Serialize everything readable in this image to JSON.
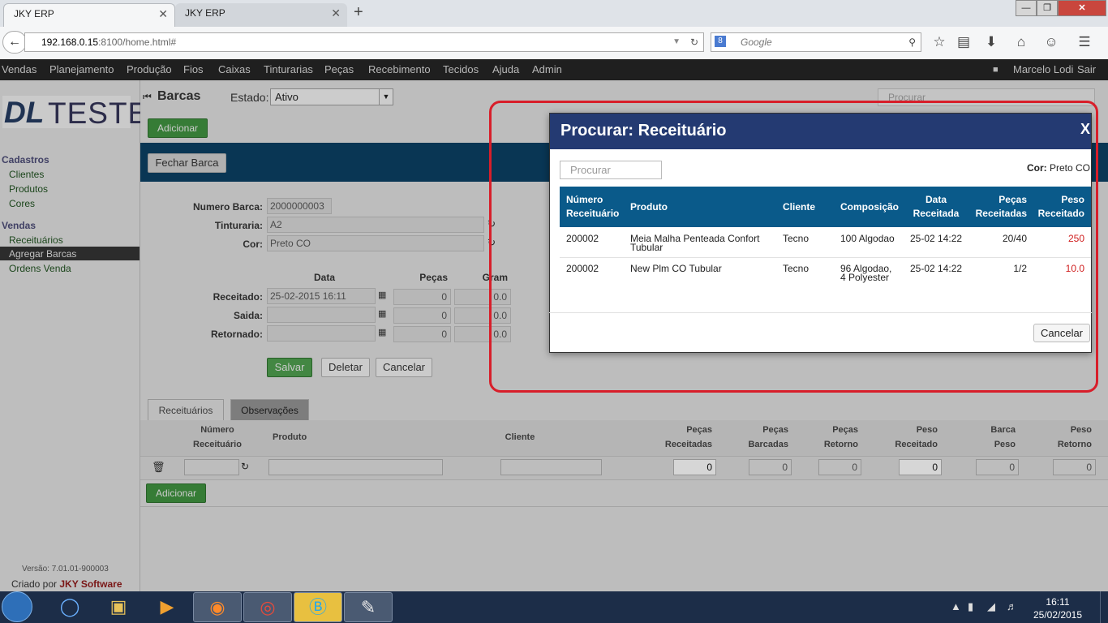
{
  "browser": {
    "tabs": [
      {
        "label": "JKY ERP",
        "close": "✕"
      },
      {
        "label": "JKY ERP",
        "close": "✕"
      }
    ],
    "new_tab": "+",
    "url_host": "192.168.0.15",
    "url_rest": ":8100/home.html#",
    "search_placeholder": "Google",
    "search_engine_letter": "8",
    "window_controls": {
      "minimize": "—",
      "maximize": "❐",
      "close": "✕"
    }
  },
  "menu": {
    "items": [
      "Vendas",
      "Planejamento",
      "Produção",
      "Fios",
      "Caixas",
      "Tinturarias",
      "Peças",
      "Recebimento",
      "Tecidos",
      "Ajuda",
      "Admin"
    ],
    "user": "Marcelo Lodi",
    "logout": "Sair"
  },
  "sidebar": {
    "logo_left": "DL",
    "logo_right": "TESTE",
    "cadastros_title": "Cadastros",
    "cadastros": [
      "Clientes",
      "Produtos",
      "Cores"
    ],
    "vendas_title": "Vendas",
    "vendas": [
      "Receituários",
      "Agregar Barcas",
      "Ordens Venda"
    ],
    "active_item": "Agregar Barcas",
    "version": "Versão: 7.01.01-900003",
    "created_by": "Criado por ",
    "company": "JKY Software"
  },
  "page": {
    "title": "Barcas",
    "estado_label": "Estado:",
    "estado_value": "Ativo",
    "search_placeholder": "Procurar",
    "add_button": "Adicionar",
    "close_barca_button": "Fechar Barca"
  },
  "form": {
    "numero_label": "Numero Barca:",
    "numero_value": "2000000003",
    "tinturaria_label": "Tinturaria:",
    "tinturaria_value": "A2",
    "cor_label": "Cor:",
    "cor_value": "Preto CO",
    "col_data": "Data",
    "col_pecas": "Peças",
    "col_gram": "Gram",
    "receitado_label": "Receitado:",
    "receitado_date": "25-02-2015 16:11",
    "receitado_pecas": "0",
    "receitado_gram": "0.0",
    "saida_label": "Saida:",
    "saida_pecas": "0",
    "saida_gram": "0.0",
    "retornado_label": "Retornado:",
    "retornado_pecas": "0",
    "retornado_gram": "0.0",
    "save": "Salvar",
    "delete": "Deletar",
    "cancel": "Cancelar"
  },
  "subtabs": [
    "Receituários",
    "Observações"
  ],
  "grid": {
    "headers": [
      [
        "Número",
        "Receituário"
      ],
      [
        "Produto",
        ""
      ],
      [
        "Cliente",
        ""
      ],
      [
        "Peças",
        "Receitadas"
      ],
      [
        "Peças",
        "Barcadas"
      ],
      [
        "Peças",
        "Retorno"
      ],
      [
        "Peso",
        "Receitado"
      ],
      [
        "Barca",
        "Peso"
      ],
      [
        "Peso",
        "Retorno"
      ]
    ],
    "row": {
      "pecas_receitadas": "0",
      "pecas_barcadas": "0",
      "pecas_retorno": "0",
      "peso_receitado": "0",
      "barca_peso": "0",
      "peso_retorno": "0"
    },
    "add_button": "Adicionar"
  },
  "modal": {
    "title": "Procurar: Receituário",
    "close": "X",
    "search_placeholder": "Procurar",
    "cor_label": "Cor:",
    "cor_value": " Preto CO",
    "columns": [
      [
        "Número",
        "Receituário"
      ],
      [
        "Produto",
        ""
      ],
      [
        "Cliente",
        ""
      ],
      [
        "Composição",
        ""
      ],
      [
        "Data",
        "Receitada"
      ],
      [
        "Peças",
        "Receitadas"
      ],
      [
        "Peso",
        "Receitado"
      ]
    ],
    "rows": [
      {
        "numero": "200002",
        "produto": [
          "Meia Malha Penteada Confort",
          "Tubular"
        ],
        "cliente": "Tecno",
        "composicao": [
          "100 Algodao",
          ""
        ],
        "data": "25-02 14:22",
        "pecas": "20/40",
        "peso": "250"
      },
      {
        "numero": "200002",
        "produto": [
          "New Plm CO Tubular",
          ""
        ],
        "cliente": "Tecno",
        "composicao": [
          "96 Algodao,",
          "4 Polyester"
        ],
        "data": "25-02 14:22",
        "pecas": "1/2",
        "peso": "10.0"
      }
    ],
    "cancel": "Cancelar"
  },
  "taskbar": {
    "time": "16:11",
    "date": "25/02/2015",
    "apps": [
      "internet-explorer",
      "file-explorer",
      "media-player",
      "firefox",
      "chrome",
      "skype",
      "paint"
    ]
  },
  "colors": {
    "accent_blue": "#243a72",
    "table_head": "#0a5a8a",
    "highlight_red": "#d81e2a",
    "button_green": "#3e8e3e"
  }
}
